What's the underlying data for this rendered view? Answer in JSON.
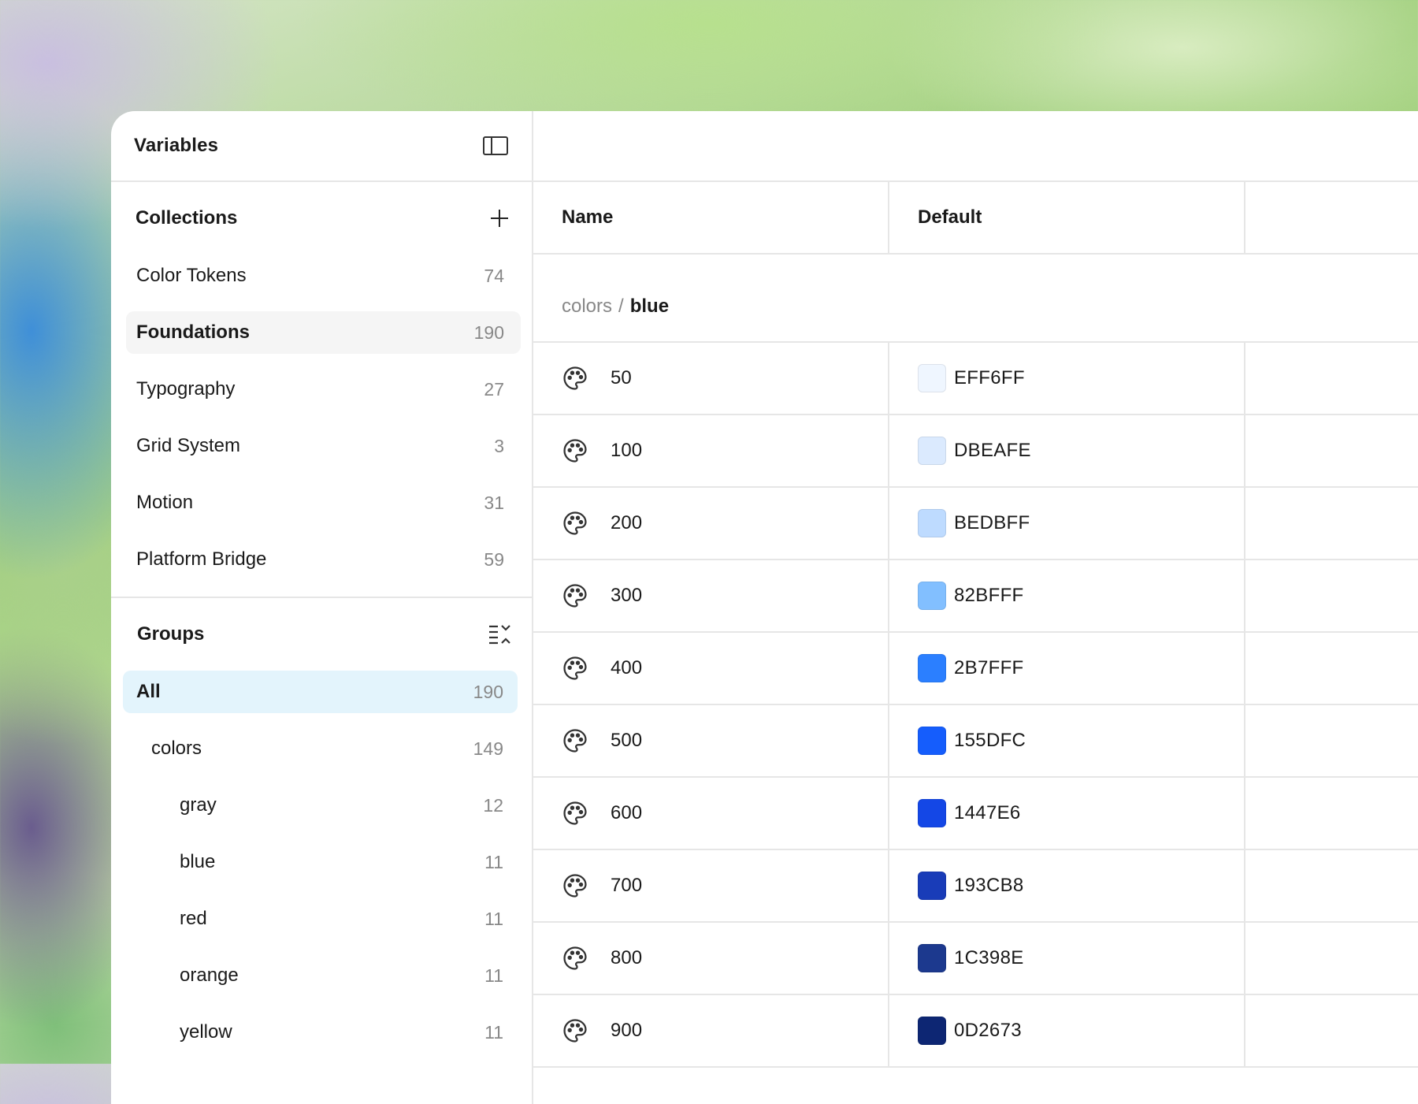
{
  "sidebar": {
    "title": "Variables",
    "collections": {
      "title": "Collections",
      "items": [
        {
          "label": "Color Tokens",
          "count": "74"
        },
        {
          "label": "Foundations",
          "count": "190"
        },
        {
          "label": "Typography",
          "count": "27"
        },
        {
          "label": "Grid System",
          "count": "3"
        },
        {
          "label": "Motion",
          "count": "31"
        },
        {
          "label": "Platform Bridge",
          "count": "59"
        }
      ]
    },
    "groups": {
      "title": "Groups",
      "items": [
        {
          "label": "All",
          "count": "190"
        },
        {
          "label": "colors",
          "count": "149"
        },
        {
          "label": "gray",
          "count": "12"
        },
        {
          "label": "blue",
          "count": "11"
        },
        {
          "label": "red",
          "count": "11"
        },
        {
          "label": "orange",
          "count": "11"
        },
        {
          "label": "yellow",
          "count": "11"
        }
      ]
    }
  },
  "table": {
    "headers": {
      "name": "Name",
      "default": "Default"
    },
    "breadcrumb": {
      "parent": "colors",
      "separator": "/",
      "current": "blue"
    },
    "rows": [
      {
        "name": "50",
        "value": "EFF6FF",
        "color": "#EFF6FF"
      },
      {
        "name": "100",
        "value": "DBEAFE",
        "color": "#DBEAFE"
      },
      {
        "name": "200",
        "value": "BEDBFF",
        "color": "#BEDBFF"
      },
      {
        "name": "300",
        "value": "82BFFF",
        "color": "#82BFFF"
      },
      {
        "name": "400",
        "value": "2B7FFF",
        "color": "#2B7FFF"
      },
      {
        "name": "500",
        "value": "155DFC",
        "color": "#155DFC"
      },
      {
        "name": "600",
        "value": "1447E6",
        "color": "#1447E6"
      },
      {
        "name": "700",
        "value": "193CB8",
        "color": "#193CB8"
      },
      {
        "name": "800",
        "value": "1C398E",
        "color": "#1C398E"
      },
      {
        "name": "900",
        "value": "0D2673",
        "color": "#0D2673"
      }
    ]
  },
  "icons": {
    "sidebar_toggle": "sidebar-toggle-icon",
    "add": "plus-icon",
    "groups_options": "collapse-list-icon",
    "variable_type": "palette-icon"
  }
}
